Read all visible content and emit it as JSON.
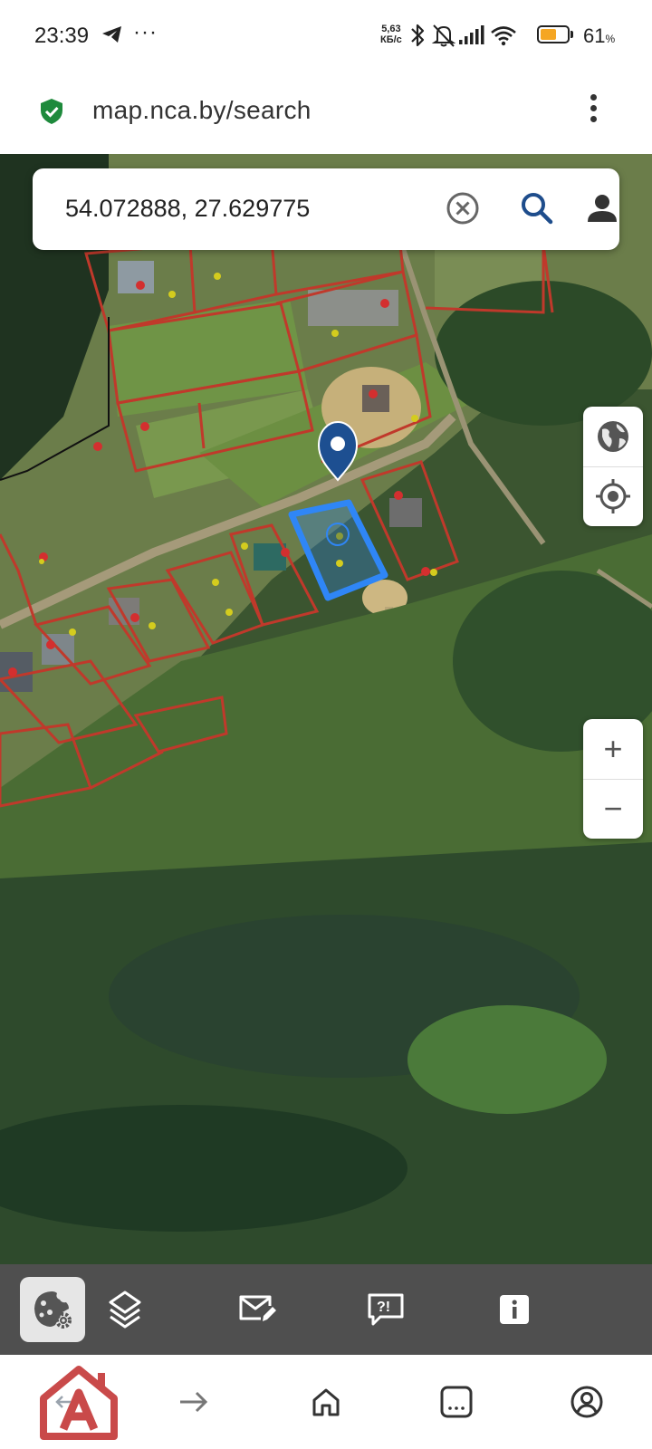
{
  "status_bar": {
    "time": "23:39",
    "overflow_dots": "···",
    "net_speed_value": "5,63",
    "net_speed_unit": "КБ/с",
    "battery_percent": "61",
    "battery_percent_sign": "%",
    "battery_level": 0.61,
    "icons": [
      "telegram-icon",
      "bluetooth-icon",
      "bell-off-icon",
      "signal-icon",
      "wifi-icon",
      "battery-icon"
    ]
  },
  "browser": {
    "url": "map.nca.by/search",
    "secure_icon": "shield-check-icon",
    "menu_icon": "kebab-menu-icon"
  },
  "search": {
    "value": "54.072888, 27.629775",
    "clear_icon": "clear-icon",
    "search_icon": "search-icon",
    "user_icon": "user-icon"
  },
  "map_controls": {
    "layers": [
      "globe-icon",
      "locate-icon"
    ],
    "zoom_in": "+",
    "zoom_out": "−"
  },
  "toolbar": {
    "items": [
      "cookie-settings-icon",
      "layers-icon",
      "mail-edit-icon",
      "feedback-icon",
      "info-icon"
    ],
    "active_index": 0
  },
  "browser_nav": {
    "items": [
      "back-icon",
      "forward-icon",
      "home-icon",
      "tabs-icon",
      "account-icon"
    ]
  },
  "colors": {
    "parcel_border": "#c0392b",
    "selected_parcel": "#2f86f6",
    "pin": "#1d4f91",
    "toolbar_bg": "#4f4f4f",
    "search_icon": "#1e4d8c",
    "shield": "#1e8a3c"
  }
}
